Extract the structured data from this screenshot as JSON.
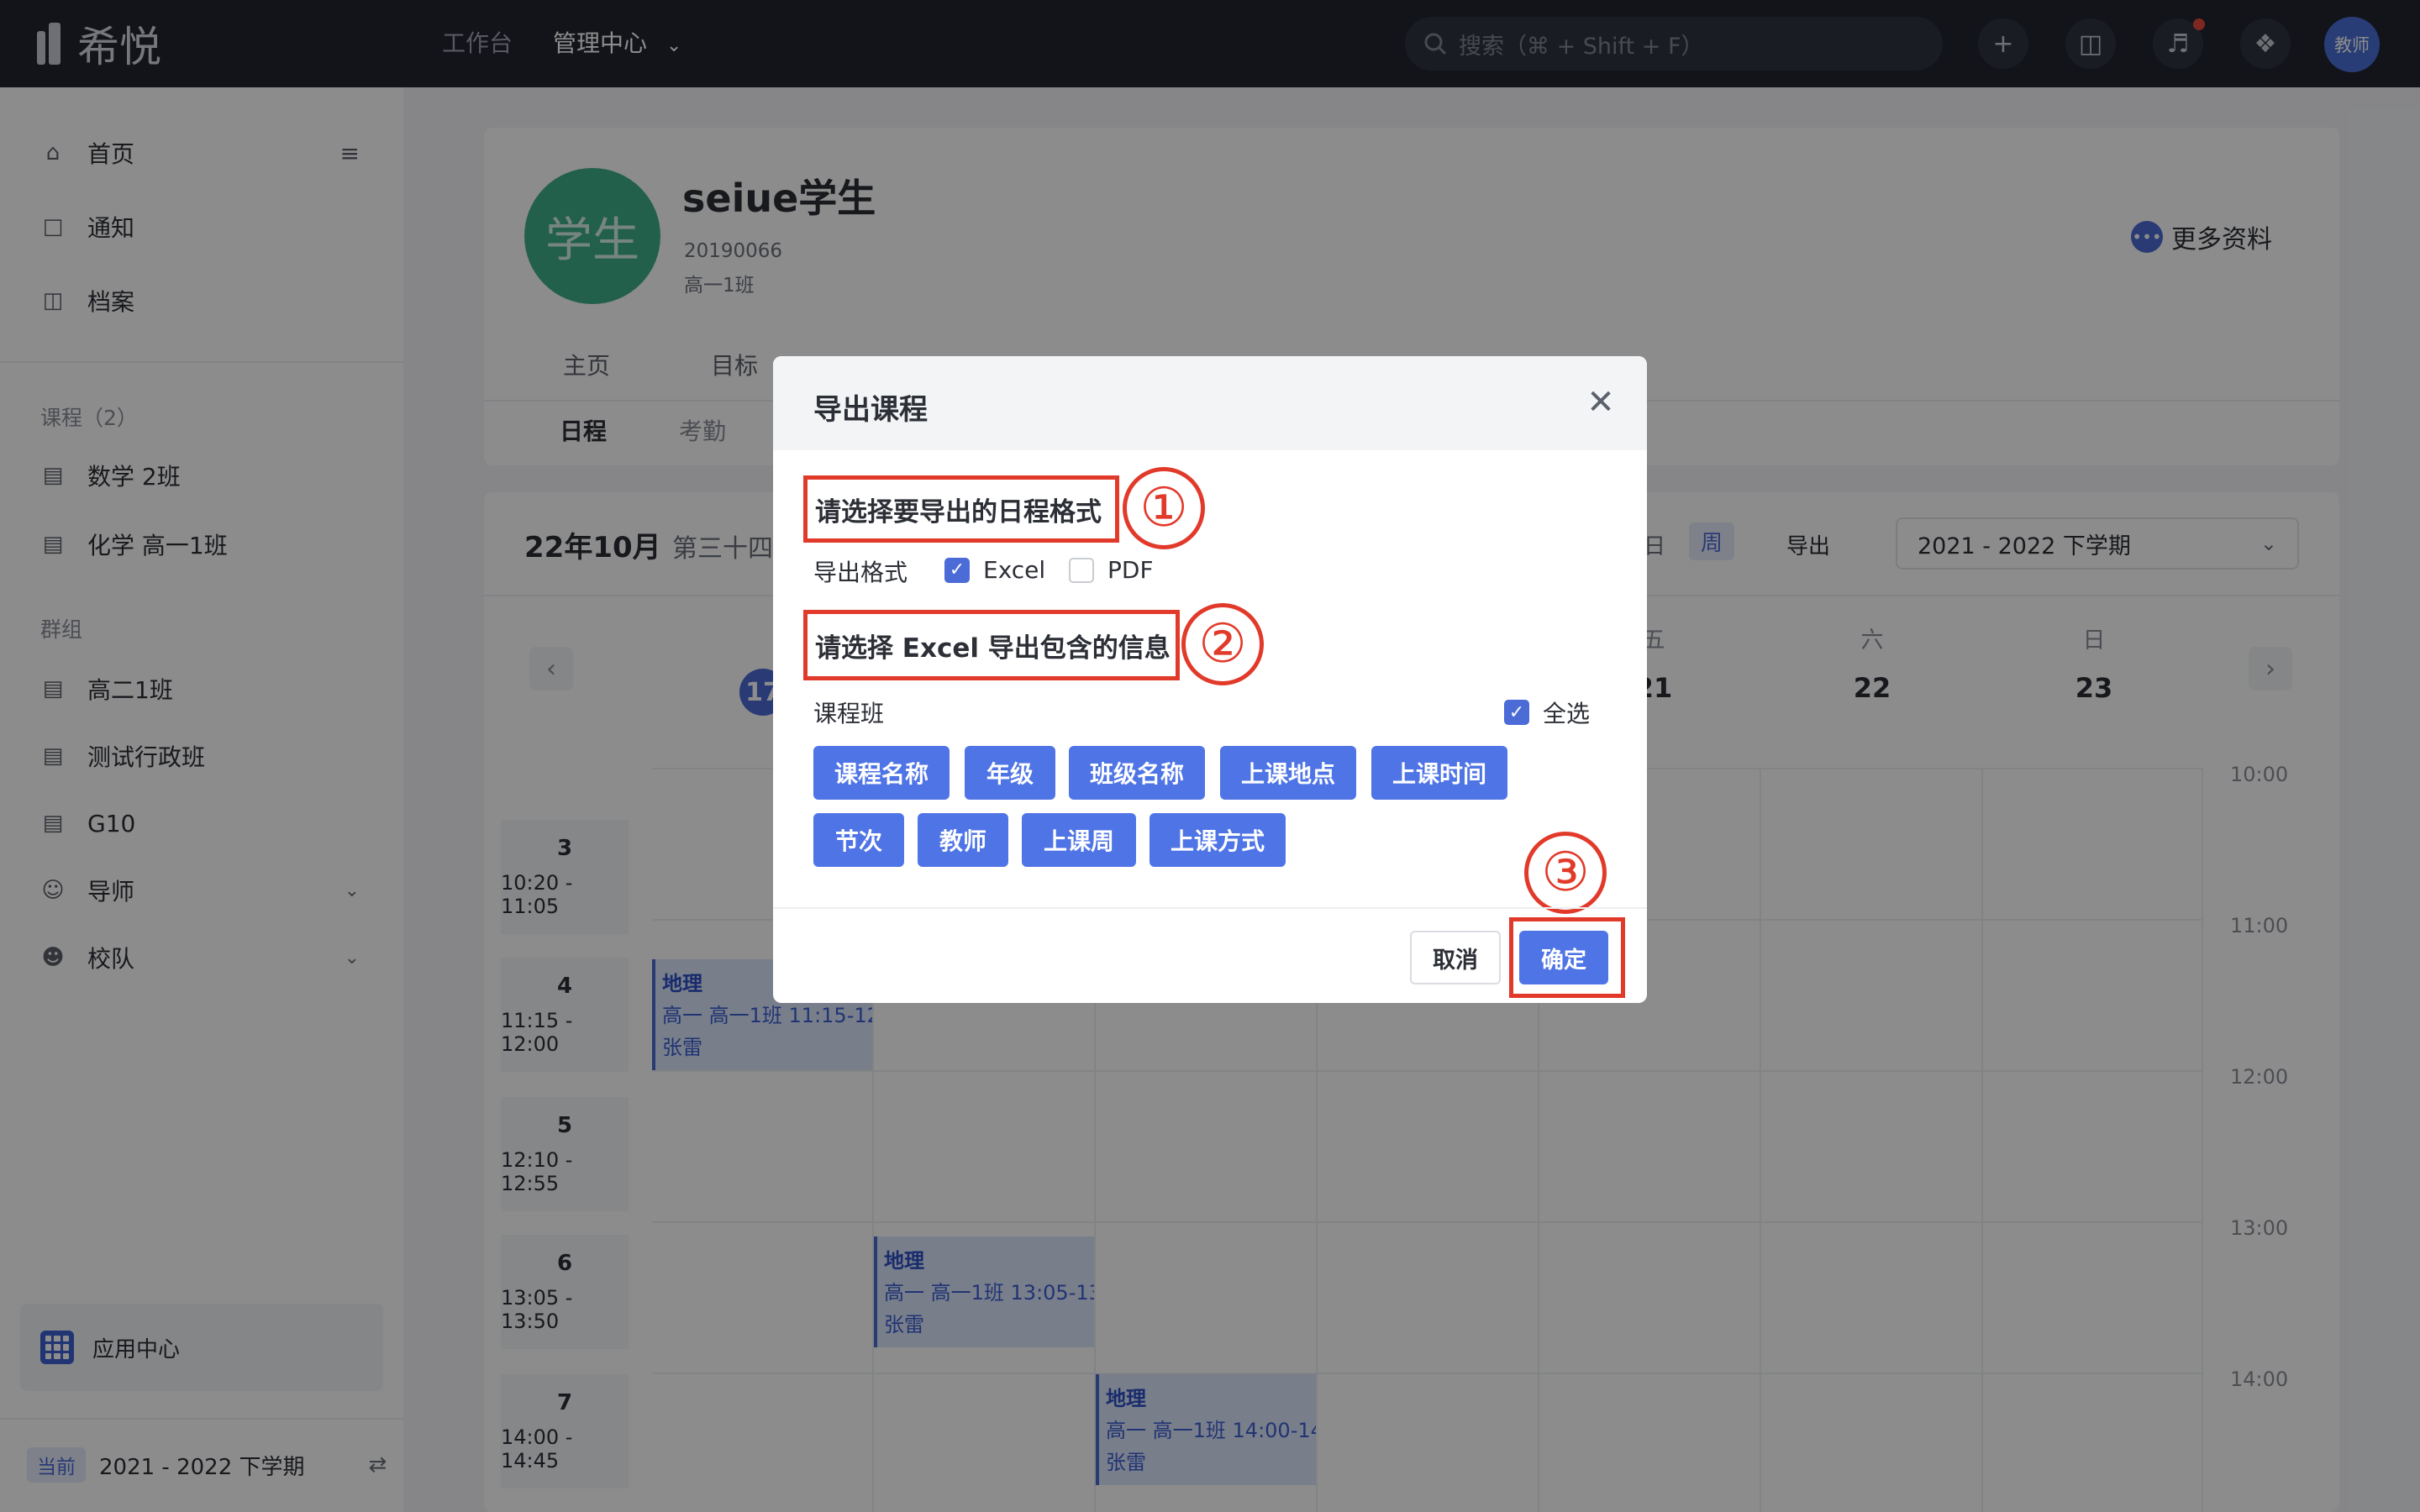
{
  "topbar": {
    "logo_text": "希悦",
    "nav": [
      "工作台",
      "管理中心"
    ],
    "search_placeholder": "搜索（⌘ + Shift + F）",
    "avatar_label": "教师",
    "icons": [
      "plus-icon",
      "chat-icon",
      "bell-icon",
      "compass-icon"
    ]
  },
  "sidebar": {
    "main_items": [
      "首页",
      "通知",
      "档案"
    ],
    "courses_title": "课程（2）",
    "courses": [
      "数学 2班",
      "化学 高一1班"
    ],
    "groups_title": "群组",
    "groups": [
      "高二1班",
      "测试行政班",
      "G10",
      "导师",
      "校队"
    ],
    "app_center": "应用中心",
    "term_badge": "当前",
    "term_label": "2021 - 2022 下学期"
  },
  "profile": {
    "avatar_text": "学生",
    "name": "seiue学生",
    "id": "20190066",
    "class": "高一1班",
    "more_info": "更多资料",
    "tabs": [
      "主页",
      "目标"
    ],
    "subtabs": [
      "日程",
      "考勤"
    ]
  },
  "calendar": {
    "month": "22年10月",
    "week": "第三十四",
    "view_day": "日",
    "view_week": "周",
    "export": "导出",
    "term_select": "2021 - 2022 下学期",
    "day_heads": [
      {
        "label": "五",
        "num": "21"
      },
      {
        "label": "六",
        "num": "22"
      },
      {
        "label": "日",
        "num": "23"
      }
    ],
    "first_day_num": "17",
    "hours": [
      "10:00",
      "11:00",
      "12:00",
      "13:00",
      "14:00"
    ],
    "periods": [
      {
        "n": "3",
        "time": "10:20 - 11:05"
      },
      {
        "n": "4",
        "time": "11:15 - 12:00"
      },
      {
        "n": "5",
        "time": "12:10 - 12:55"
      },
      {
        "n": "6",
        "time": "13:05 - 13:50"
      },
      {
        "n": "7",
        "time": "14:00 - 14:45"
      }
    ],
    "events": [
      {
        "subject": "地理",
        "detail": "高一  高一1班  11:15-12",
        "teacher": "张雷"
      },
      {
        "subject": "地理",
        "detail": "高一  高一1班  13:05-13",
        "teacher": "张雷"
      },
      {
        "subject": "地理",
        "detail": "高一  高一1班  14:00-14",
        "teacher": "张雷"
      }
    ]
  },
  "modal": {
    "title": "导出课程",
    "step1_title": "请选择要导出的日程格式",
    "format_label": "导出格式",
    "format_excel": "Excel",
    "format_pdf": "PDF",
    "step2_title": "请选择 Excel 导出包含的信息",
    "group_label": "课程班",
    "select_all": "全选",
    "tags": [
      "课程名称",
      "年级",
      "班级名称",
      "上课地点",
      "上课时间",
      "节次",
      "教师",
      "上课周",
      "上课方式"
    ],
    "cancel": "取消",
    "confirm": "确定",
    "markers": [
      "①",
      "②",
      "③"
    ],
    "accent_color": "#4f74e6",
    "annotation_color": "#e23a2a"
  }
}
